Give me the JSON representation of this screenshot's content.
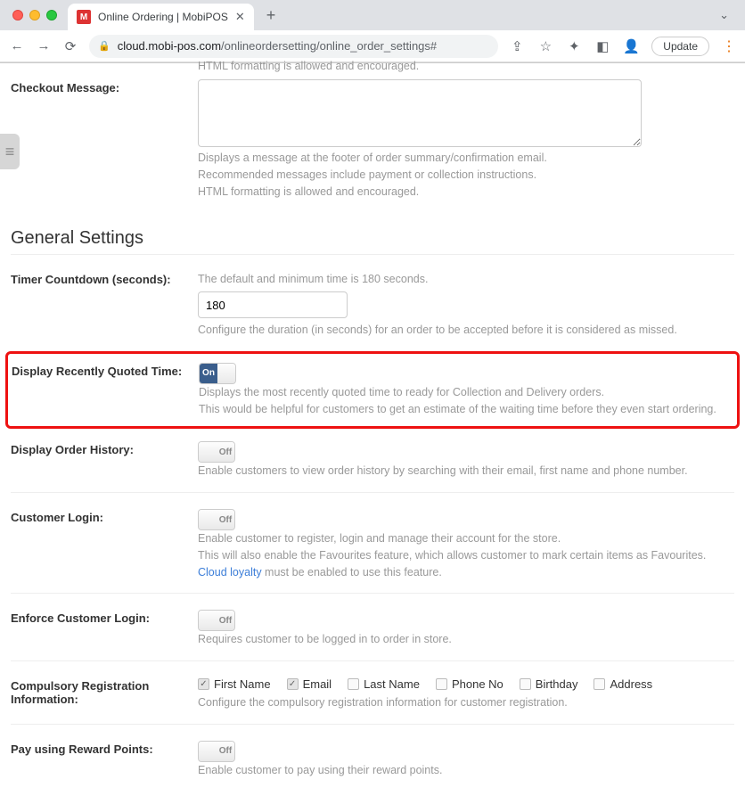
{
  "browser": {
    "tab_title": "Online Ordering | MobiPOS",
    "favicon_letter": "M",
    "url_host": "cloud.mobi-pos.com",
    "url_path": "/onlineordersetting/online_order_settings#",
    "update_label": "Update"
  },
  "truncated_top": "HTML formatting is allowed and encouraged.",
  "checkout": {
    "label": "Checkout Message:",
    "help1": "Displays a message at the footer of order summary/confirmation email.",
    "help2": "Recommended messages include payment or collection instructions.",
    "help3": "HTML formatting is allowed and encouraged."
  },
  "section_general": "General Settings",
  "timer": {
    "label": "Timer Countdown (seconds):",
    "hint": "The default and minimum time is 180 seconds.",
    "value": "180",
    "help": "Configure the duration (in seconds) for an order to be accepted before it is considered as missed."
  },
  "quoted": {
    "label": "Display Recently Quoted Time:",
    "state": "On",
    "help1": "Displays the most recently quoted time to ready for Collection and Delivery orders.",
    "help2": "This would be helpful for customers to get an estimate of the waiting time before they even start ordering."
  },
  "history": {
    "label": "Display Order History:",
    "state": "Off",
    "help": "Enable customers to view order history by searching with their email, first name and phone number."
  },
  "login": {
    "label": "Customer Login:",
    "state": "Off",
    "help1": "Enable customer to register, login and manage their account for the store.",
    "help2": "This will also enable the Favourites feature, which allows customer to mark certain items as Favourites.",
    "link": "Cloud loyalty",
    "help3": " must be enabled to use this feature."
  },
  "enforce": {
    "label": "Enforce Customer Login:",
    "state": "Off",
    "help": "Requires customer to be logged in to order in store."
  },
  "compulsory": {
    "label": "Compulsory Registration Information:",
    "options": {
      "first_name": "First Name",
      "email": "Email",
      "last_name": "Last Name",
      "phone_no": "Phone No",
      "birthday": "Birthday",
      "address": "Address"
    },
    "help": "Configure the compulsory registration information for customer registration."
  },
  "rewards": {
    "label": "Pay using Reward Points:",
    "state": "Off",
    "help": "Enable customer to pay using their reward points."
  }
}
